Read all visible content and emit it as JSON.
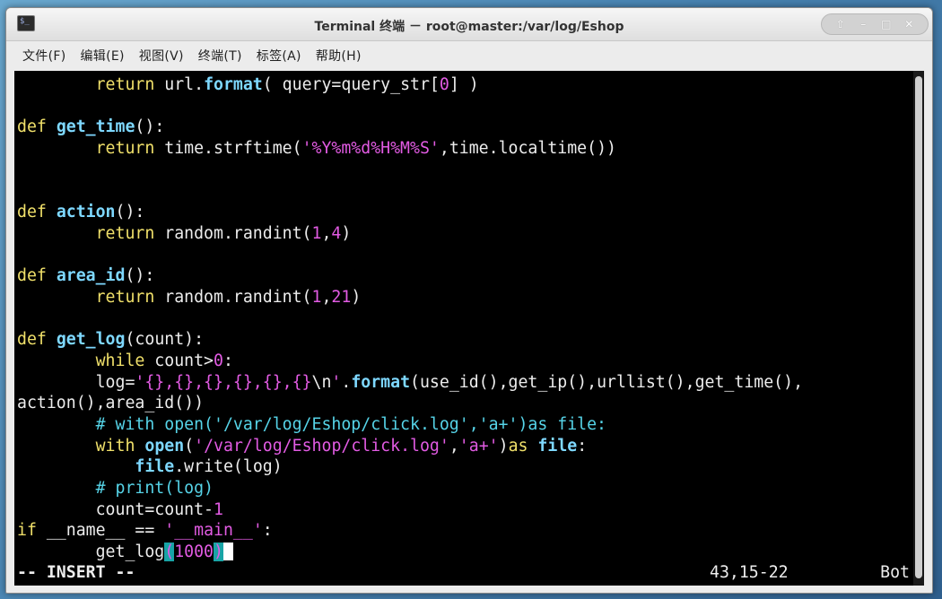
{
  "window": {
    "title": "Terminal 终端 － root@master:/var/log/Eshop",
    "app_icon": "terminal-icon",
    "controls": [
      "⇧",
      "–",
      "□",
      "✕"
    ]
  },
  "menu": [
    "文件(F)",
    "编辑(E)",
    "视图(V)",
    "终端(T)",
    "标签(A)",
    "帮助(H)"
  ],
  "code_lines": [
    [
      {
        "t": "        "
      },
      {
        "t": "return",
        "c": "ret"
      },
      {
        "t": " url."
      },
      {
        "t": "format",
        "c": "bi"
      },
      {
        "t": "( query=query_str["
      },
      {
        "t": "0",
        "c": "nm"
      },
      {
        "t": "] )"
      }
    ],
    [],
    [
      {
        "t": "def",
        "c": "kw"
      },
      {
        "t": " "
      },
      {
        "t": "get_time",
        "c": "fn"
      },
      {
        "t": "():"
      }
    ],
    [
      {
        "t": "        "
      },
      {
        "t": "return",
        "c": "ret"
      },
      {
        "t": " time.strftime("
      },
      {
        "t": "'%Y%m%d%H%M%S'",
        "c": "st"
      },
      {
        "t": ",time.localtime())"
      }
    ],
    [],
    [],
    [
      {
        "t": "def",
        "c": "kw"
      },
      {
        "t": " "
      },
      {
        "t": "action",
        "c": "fn"
      },
      {
        "t": "():"
      }
    ],
    [
      {
        "t": "        "
      },
      {
        "t": "return",
        "c": "ret"
      },
      {
        "t": " random.randint("
      },
      {
        "t": "1",
        "c": "nm"
      },
      {
        "t": ","
      },
      {
        "t": "4",
        "c": "nm"
      },
      {
        "t": ")"
      }
    ],
    [],
    [
      {
        "t": "def",
        "c": "kw"
      },
      {
        "t": " "
      },
      {
        "t": "area_id",
        "c": "fn"
      },
      {
        "t": "():"
      }
    ],
    [
      {
        "t": "        "
      },
      {
        "t": "return",
        "c": "ret"
      },
      {
        "t": " random.randint("
      },
      {
        "t": "1",
        "c": "nm"
      },
      {
        "t": ","
      },
      {
        "t": "21",
        "c": "nm"
      },
      {
        "t": ")"
      }
    ],
    [],
    [
      {
        "t": "def",
        "c": "kw"
      },
      {
        "t": " "
      },
      {
        "t": "get_log",
        "c": "fn"
      },
      {
        "t": "(count):"
      }
    ],
    [
      {
        "t": "        "
      },
      {
        "t": "while",
        "c": "ret"
      },
      {
        "t": " count>"
      },
      {
        "t": "0",
        "c": "nm"
      },
      {
        "t": ":"
      }
    ],
    [
      {
        "t": "        log="
      },
      {
        "t": "'{},{},{},{},{},{}",
        "c": "st"
      },
      {
        "t": "\\n"
      },
      {
        "t": "'",
        "c": "st"
      },
      {
        "t": "."
      },
      {
        "t": "format",
        "c": "bi"
      },
      {
        "t": "(use_id(),get_ip(),urllist(),get_time(),"
      }
    ],
    [
      {
        "t": "action(),area_id())"
      }
    ],
    [
      {
        "t": "        "
      },
      {
        "t": "# with open('/var/log/Eshop/click.log','a+')as file:",
        "c": "cm"
      }
    ],
    [
      {
        "t": "        "
      },
      {
        "t": "with",
        "c": "ret"
      },
      {
        "t": " "
      },
      {
        "t": "open",
        "c": "bi"
      },
      {
        "t": "("
      },
      {
        "t": "'/var/log/Eshop/click.log'",
        "c": "st"
      },
      {
        "t": ","
      },
      {
        "t": "'a+'",
        "c": "st"
      },
      {
        "t": ")"
      },
      {
        "t": "as",
        "c": "ret"
      },
      {
        "t": " "
      },
      {
        "t": "file",
        "c": "bi"
      },
      {
        "t": ":"
      }
    ],
    [
      {
        "t": "            "
      },
      {
        "t": "file",
        "c": "bi"
      },
      {
        "t": ".write(log)"
      }
    ],
    [
      {
        "t": "        "
      },
      {
        "t": "# print(log)",
        "c": "cm"
      }
    ],
    [
      {
        "t": "        count=count-"
      },
      {
        "t": "1",
        "c": "nm"
      }
    ],
    [
      {
        "t": "if",
        "c": "kw"
      },
      {
        "t": " __name__ == "
      },
      {
        "t": "'__main__'",
        "c": "st"
      },
      {
        "t": ":"
      }
    ],
    [
      {
        "t": "        get_log"
      },
      {
        "t": "(",
        "c": "cursor-pair"
      },
      {
        "t": "1000",
        "c": "nm"
      },
      {
        "t": ")",
        "c": "cursor-pair"
      },
      {
        "t": "",
        "c": "cursor"
      }
    ]
  ],
  "status": {
    "mode": "-- INSERT --",
    "position": "43,15-22",
    "scroll": "Bot"
  },
  "colors": {
    "keyword": "#f0e06a",
    "function": "#7ed8ff",
    "number_string": "#e25be3",
    "comment": "#56d4e8",
    "background": "#000000"
  }
}
